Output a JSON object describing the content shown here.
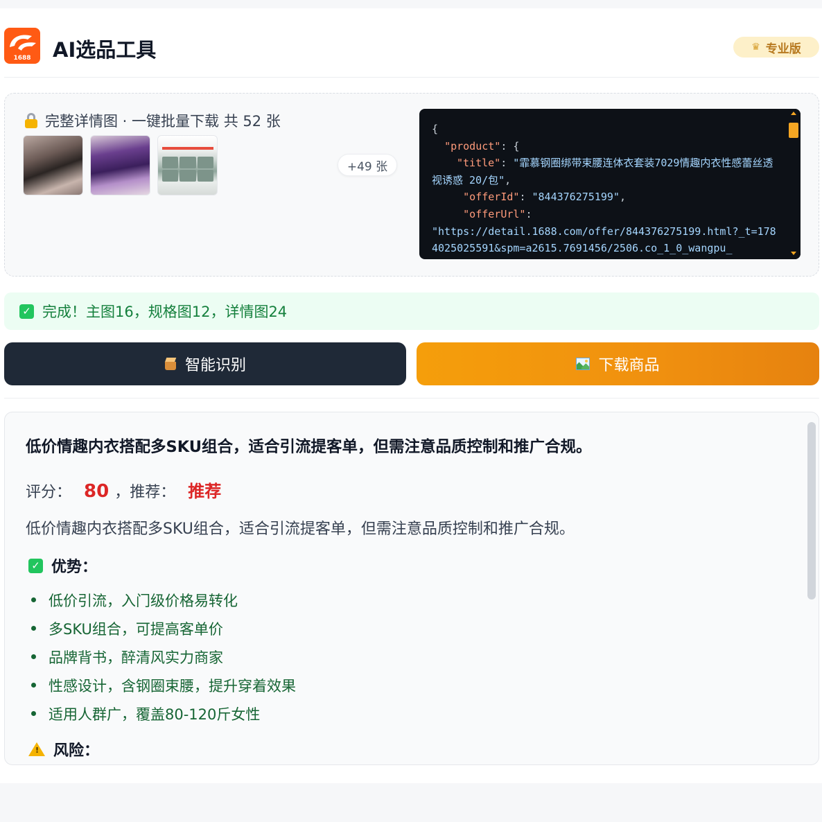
{
  "header": {
    "logo_text": "1688",
    "title": "AI选品工具",
    "pro_badge": "专业版"
  },
  "images": {
    "heading": "完整详情图 · 一键批量下载 共 52 张",
    "more_label": "+49 张",
    "thumbnails": [
      "product-photo-1",
      "product-photo-2",
      "product-detail-poster"
    ]
  },
  "json_preview": {
    "line_open": "{",
    "product_key": "\"product\"",
    "product_open": ": {",
    "title_key": "\"title\"",
    "title_val": "\"霏慕钢圈绑带束腰连体衣套装7029情趣内衣性感蕾丝透视诱惑 20/包\"",
    "offerid_key": "\"offerId\"",
    "offerid_val": "\"844376275199\"",
    "offerurl_key": "\"offerUrl\"",
    "offerurl_val": "\"https://detail.1688.com/offer/844376275199.html?_t=1784025025591&spm=a2615.7691456/2506.co_1_0_wangpu_"
  },
  "status": {
    "success_text": "完成！主图16，规格图12，详情图24"
  },
  "actions": {
    "identify_label": "智能识别",
    "download_label": "下载商品"
  },
  "result": {
    "summary_title": "低价情趣内衣搭配多SKU组合，适合引流提客单，但需注意品质控制和推广合规。",
    "score_label": "评分：",
    "score_value": "80",
    "rec_label": "，推荐：",
    "rec_value": "推荐",
    "summary_text": "低价情趣内衣搭配多SKU组合，适合引流提客单，但需注意品质控制和推广合规。",
    "advantages_title": "优势：",
    "advantages": [
      "低价引流，入门级价格易转化",
      "多SKU组合，可提高客单价",
      "品牌背书，醉清风实力商家",
      "性感设计，含钢圈束腰，提升穿着效果",
      "适用人群广，覆盖80-120斤女性"
    ],
    "risks_title": "风险："
  },
  "colors": {
    "brand_orange": "#ff5a14",
    "accent_red": "#dc2626",
    "success_green": "#15803d",
    "dark_button": "#1f2937",
    "download_orange": "#f59e0b"
  }
}
